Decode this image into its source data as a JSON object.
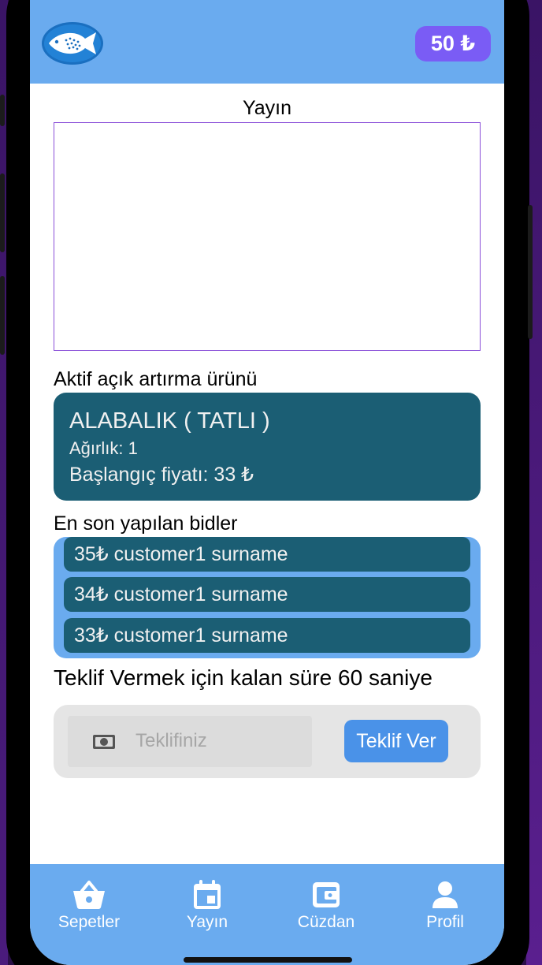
{
  "header": {
    "balance": "50 ₺"
  },
  "stream": {
    "title": "Yayın"
  },
  "auction": {
    "section_title": "Aktif açık artırma ürünü",
    "product_name": "ALABALIK ( TATLI )",
    "weight": "Ağırlık: 1",
    "start_price": "Başlangıç fiyatı: 33 ₺"
  },
  "bids": {
    "section_title": "En son yapılan bidler",
    "items": [
      "35₺ customer1 surname",
      "34₺ customer1 surname",
      "33₺ customer1 surname"
    ]
  },
  "countdown": {
    "text": "Teklif Vermek için kalan süre 60 saniye"
  },
  "bid_form": {
    "placeholder": "Teklifiniz",
    "value": "",
    "button_label": "Teklif Ver"
  },
  "tabbar": {
    "items": [
      {
        "label": "Sepetler",
        "icon": "basket-icon"
      },
      {
        "label": "Yayın",
        "icon": "calendar-icon"
      },
      {
        "label": "Cüzdan",
        "icon": "wallet-icon"
      },
      {
        "label": "Profil",
        "icon": "person-icon"
      }
    ]
  },
  "colors": {
    "primary_blue": "#6aabef",
    "card_teal": "#1b5e74",
    "balance_purple": "#7a5cf5",
    "button_blue": "#4a92e8",
    "stream_border": "#8a4fd8"
  }
}
